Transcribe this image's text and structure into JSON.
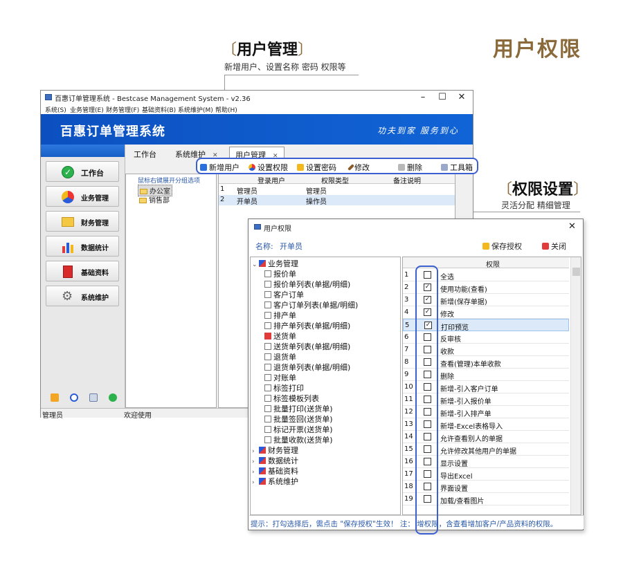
{
  "page_title": "用户权限",
  "callout_user": {
    "title": "用户管理",
    "subtitle": "新增用户、设置名称 密码 权限等"
  },
  "callout_perm": {
    "title": "权限设置",
    "subtitle": "灵活分配 精细管理"
  },
  "main_window": {
    "title": "百惠订单管理系统 - Bestcase Management System - v2.36",
    "menu": [
      "系统(S)",
      "业务管理(E)",
      "财务管理(F)",
      "基础资料(B)",
      "系统维护(M)",
      "帮助(H)"
    ],
    "app_name": "百惠订单管理系统",
    "slogan": "功夫到家 服务到心",
    "nav": [
      {
        "label": "工作台",
        "icon": "check-circle-icon"
      },
      {
        "label": "业务管理",
        "icon": "recycle-icon"
      },
      {
        "label": "财务管理",
        "icon": "folder-icon"
      },
      {
        "label": "数据统计",
        "icon": "bar-chart-icon"
      },
      {
        "label": "基础资料",
        "icon": "book-icon"
      },
      {
        "label": "系统维护",
        "icon": "gear-icon"
      }
    ],
    "tabs": [
      "工作台",
      "系统维护",
      "用户管理"
    ],
    "toolbar": [
      "新增用户",
      "设置权限",
      "设置密码",
      "修改",
      "删除",
      "工具箱"
    ],
    "group_hint": "鼠标右键展开分组选项",
    "groups": [
      "办公室",
      "销售部"
    ],
    "user_table": {
      "headers": [
        "登录用户",
        "权限类型",
        "备注说明"
      ],
      "rows": [
        {
          "num": "1",
          "user": "管理员",
          "type": "管理员",
          "note": ""
        },
        {
          "num": "2",
          "user": "开单员",
          "type": "操作员",
          "note": ""
        }
      ]
    },
    "status": [
      "管理员",
      "欢迎使用"
    ]
  },
  "perm_dialog": {
    "title": "用户权限",
    "name_label": "名称:",
    "name_value": "开单员",
    "save_label": "保存授权",
    "close_label": "关闭",
    "tree": {
      "root": "业务管理",
      "children": [
        "报价单",
        "报价单列表(单据/明细)",
        "客户订单",
        "客户订单列表(单据/明细)",
        "排产单",
        "排产单列表(单据/明细)",
        "送货单",
        "送货单列表(单据/明细)",
        "退货单",
        "退货单列表(单据/明细)",
        "对账单",
        "标签打印",
        "标签模板列表",
        "批量打印(送货单)",
        "批量签回(送货单)",
        "标记开票(送货单)",
        "批量收款(送货单)"
      ],
      "collapsed": [
        "财务管理",
        "数据统计",
        "基础资料",
        "系统维护"
      ]
    },
    "grid_header": "权限",
    "perms": [
      {
        "num": "1",
        "label": "全选",
        "checked": false
      },
      {
        "num": "2",
        "label": "使用功能(查看)",
        "checked": true
      },
      {
        "num": "3",
        "label": "新增(保存单据)",
        "checked": true
      },
      {
        "num": "4",
        "label": "修改",
        "checked": true
      },
      {
        "num": "5",
        "label": "打印预览",
        "checked": true
      },
      {
        "num": "6",
        "label": "反审核",
        "checked": false
      },
      {
        "num": "7",
        "label": "收款",
        "checked": false
      },
      {
        "num": "8",
        "label": "查看(管理)本单收款",
        "checked": false
      },
      {
        "num": "9",
        "label": "删除",
        "checked": false
      },
      {
        "num": "10",
        "label": "新增-引入客户订单",
        "checked": false
      },
      {
        "num": "11",
        "label": "新增-引入报价单",
        "checked": false
      },
      {
        "num": "12",
        "label": "新增-引入排产单",
        "checked": false
      },
      {
        "num": "13",
        "label": "新增-Excel表格导入",
        "checked": false
      },
      {
        "num": "14",
        "label": "允许查看别人的单据",
        "checked": false
      },
      {
        "num": "15",
        "label": "允许修改其他用户的单据",
        "checked": false
      },
      {
        "num": "16",
        "label": "显示设置",
        "checked": false
      },
      {
        "num": "17",
        "label": "导出Excel",
        "checked": false
      },
      {
        "num": "18",
        "label": "界面设置",
        "checked": false
      },
      {
        "num": "19",
        "label": "加载/查看图片",
        "checked": false
      }
    ],
    "hint": "提示：打勾选择后，需点击 \"保存授权\"生效！ 注：      增权限，含查看增加客户/产品资料的权限。"
  }
}
